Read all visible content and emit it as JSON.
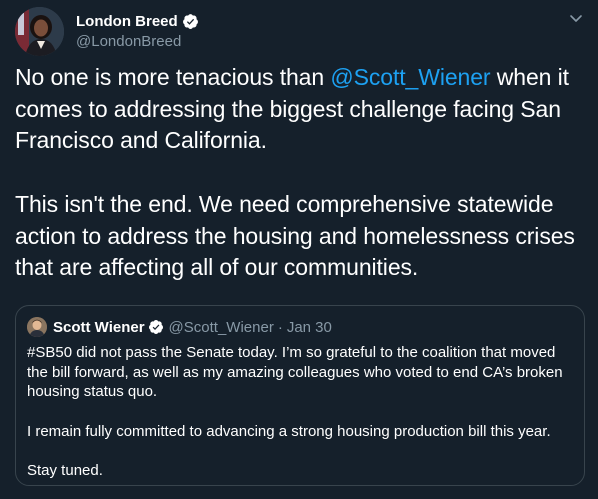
{
  "author": {
    "display_name": "London Breed",
    "handle": "@LondonBreed"
  },
  "tweet": {
    "line1_before": "No one is more tenacious than ",
    "mention": "@Scott_Wiener",
    "line1_after": " when it comes to addressing the biggest challenge facing San Francisco and California.",
    "paragraph2": "This isn't the end. We need comprehensive statewide action to address the housing and homelessness crises that are affecting all of our communities."
  },
  "quoted_tweet": {
    "display_name": "Scott Wiener",
    "handle": "@Scott_Wiener",
    "separator": "·",
    "date": "Jan 30",
    "paragraph1": "#SB50 did not pass the Senate today. I’m so grateful to the coalition that moved the bill forward, as well as my amazing colleagues who voted to end CA’s broken housing status quo.",
    "paragraph2": "I remain fully committed to advancing a strong housing production bill this year.",
    "paragraph3": "Stay tuned."
  },
  "icons": {
    "verified": "verified-badge-icon",
    "caret": "chevron-down-icon"
  },
  "colors": {
    "background": "#15202b",
    "text": "#ffffff",
    "secondary_text": "#8899a6",
    "link": "#1da1f2",
    "border": "#38444d"
  }
}
